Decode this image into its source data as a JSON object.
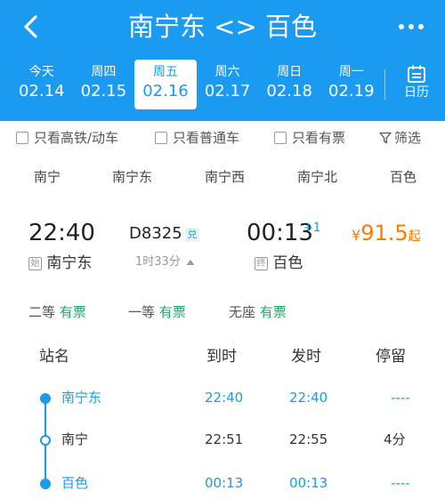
{
  "header": {
    "title": "南宁东 <> 百色",
    "back_icon": "chevron-left-icon",
    "more_icon": "more-dots-icon"
  },
  "dates": [
    {
      "weekday": "今天",
      "date": "02.14",
      "active": false
    },
    {
      "weekday": "周四",
      "date": "02.15",
      "active": false
    },
    {
      "weekday": "周五",
      "date": "02.16",
      "active": true
    },
    {
      "weekday": "周六",
      "date": "02.17",
      "active": false
    },
    {
      "weekday": "周日",
      "date": "02.18",
      "active": false
    },
    {
      "weekday": "周一",
      "date": "02.19",
      "active": false
    }
  ],
  "calendar": {
    "label": "日历",
    "icon": "calendar-icon"
  },
  "filters": {
    "high_speed": "只看高铁/动车",
    "normal": "只看普通车",
    "has_ticket": "只看有票",
    "filter": "筛选"
  },
  "stations": [
    "南宁",
    "南宁东",
    "南宁西",
    "南宁北",
    "百色"
  ],
  "train": {
    "dep_time": "22:40",
    "number": "D8325",
    "badge": "兑",
    "arr_time": "00:13",
    "plus_day": "+1",
    "price_symbol": "¥",
    "price": "91.5",
    "price_suffix": "起",
    "dep_tag": "始",
    "dep_station": "南宁东",
    "duration": "1时33分",
    "arr_tag": "终",
    "arr_station": "百色"
  },
  "seats": [
    {
      "class": "二等",
      "status": "有票"
    },
    {
      "class": "一等",
      "status": "有票"
    },
    {
      "class": "无座",
      "status": "有票"
    }
  ],
  "stop_headers": {
    "station": "站名",
    "arrive": "到时",
    "depart": "发时",
    "stay": "停留"
  },
  "stops": [
    {
      "name": "南宁东",
      "arrive": "22:40",
      "depart": "22:40",
      "stay": "----"
    },
    {
      "name": "南宁",
      "arrive": "22:51",
      "depart": "22:55",
      "stay": "4分"
    },
    {
      "name": "百色",
      "arrive": "00:13",
      "depart": "00:13",
      "stay": "----"
    }
  ],
  "colors": {
    "primary": "#1a9af0",
    "price": "#ff7a00",
    "available": "#1aaa6a"
  }
}
